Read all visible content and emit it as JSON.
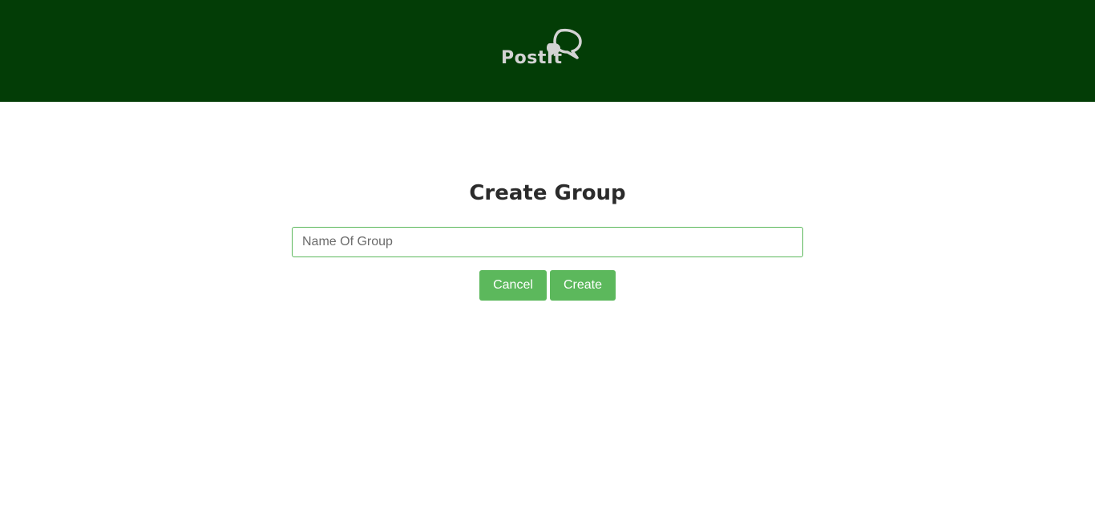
{
  "header": {
    "logo_text": "PostIt",
    "logo_icon": "chat-bubbles-icon",
    "background_color": "#033d06"
  },
  "main": {
    "title": "Create Group",
    "group_name_input": {
      "placeholder": "Name Of Group",
      "value": ""
    },
    "cancel_label": "Cancel",
    "create_label": "Create",
    "accent_color": "#5cb85c"
  }
}
